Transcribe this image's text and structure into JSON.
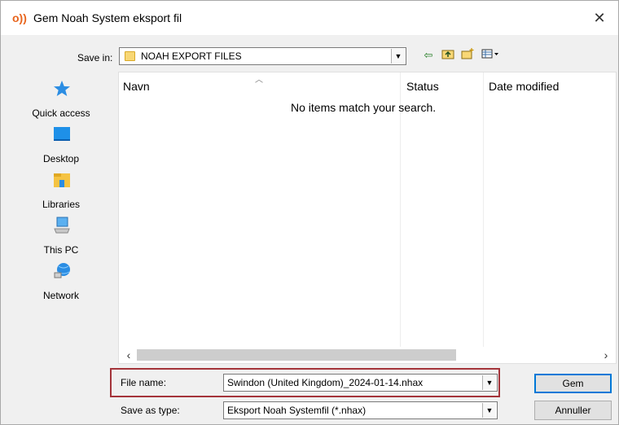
{
  "window": {
    "title": "Gem Noah System eksport fil",
    "close_glyph": "✕"
  },
  "savein": {
    "label": "Save in:",
    "value": "NOAH EXPORT FILES"
  },
  "toolbar": {
    "icons": [
      "back-icon",
      "up-folder-icon",
      "new-folder-icon",
      "view-menu-icon"
    ]
  },
  "places": [
    {
      "label": "Quick access",
      "icon": "star-icon"
    },
    {
      "label": "Desktop",
      "icon": "desktop-icon"
    },
    {
      "label": "Libraries",
      "icon": "libraries-icon"
    },
    {
      "label": "This PC",
      "icon": "computer-icon"
    },
    {
      "label": "Network",
      "icon": "network-icon"
    }
  ],
  "filelist": {
    "columns": [
      "Navn",
      "Status",
      "Date modified"
    ],
    "empty_message": "No items match your search."
  },
  "filename": {
    "label": "File name:",
    "value": "Swindon (United Kingdom)_2024-01-14.nhax"
  },
  "savetype": {
    "label": "Save as type:",
    "value": "Eksport Noah Systemfil (*.nhax)"
  },
  "buttons": {
    "save": "Gem",
    "cancel": "Annuller"
  },
  "colors": {
    "accent": "#0078d7",
    "highlight_border": "#a4343a",
    "title_icon": "#e8641c"
  }
}
